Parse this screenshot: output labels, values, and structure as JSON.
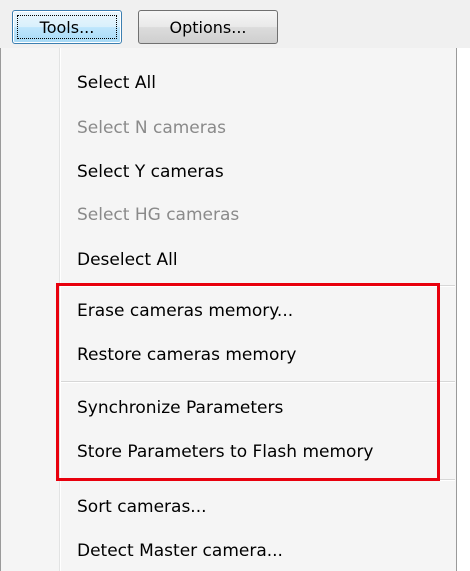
{
  "toolbar": {
    "tools_label": "Tools...",
    "options_label": "Options..."
  },
  "menu": {
    "items": [
      {
        "label": "Select All",
        "enabled": true
      },
      {
        "label": "Select N cameras",
        "enabled": false
      },
      {
        "label": "Select Y cameras",
        "enabled": true
      },
      {
        "label": "Select HG cameras",
        "enabled": false
      },
      {
        "label": "Deselect All",
        "enabled": true
      },
      {
        "label": "Erase cameras memory...",
        "enabled": true
      },
      {
        "label": "Restore cameras memory",
        "enabled": true
      },
      {
        "label": "Synchronize Parameters",
        "enabled": true
      },
      {
        "label": "Store Parameters to Flash memory",
        "enabled": true
      },
      {
        "label": "Sort cameras...",
        "enabled": true
      },
      {
        "label": "Detect Master camera...",
        "enabled": true
      }
    ]
  },
  "colors": {
    "highlight_border": "#e8000d",
    "disabled_text": "#8a8a8a"
  }
}
